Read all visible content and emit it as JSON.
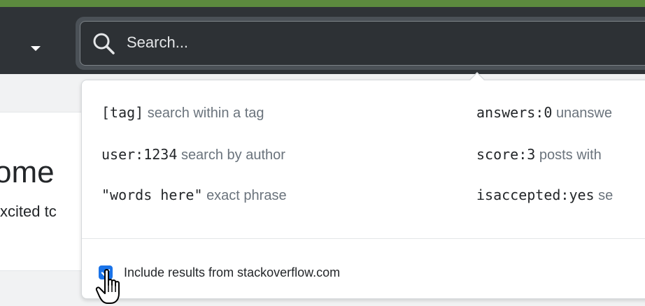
{
  "colors": {
    "topbar": "#2f3337",
    "accent_green": "#5c8a3e",
    "checkbox_blue": "#1a73e8",
    "hint_text": "#6a737c"
  },
  "header": {
    "menu_caret_icon": "chevron-down-icon",
    "search": {
      "icon": "search-icon",
      "placeholder": "Search...",
      "value": ""
    }
  },
  "background": {
    "heading": "ome",
    "subtext": "xcited tc"
  },
  "popover": {
    "tips": [
      {
        "token": "[tag]",
        "desc": "search within a tag"
      },
      {
        "token": "user:1234",
        "desc": "search by author"
      },
      {
        "token": "\"words here\"",
        "desc": "exact phrase"
      },
      {
        "token": "answers:0",
        "desc": "unanswe"
      },
      {
        "token": "score:3",
        "desc": "posts with"
      },
      {
        "token": "isaccepted:yes",
        "desc": "se"
      }
    ],
    "include": {
      "checked": true,
      "label": "Include results from stackoverflow.com"
    }
  }
}
